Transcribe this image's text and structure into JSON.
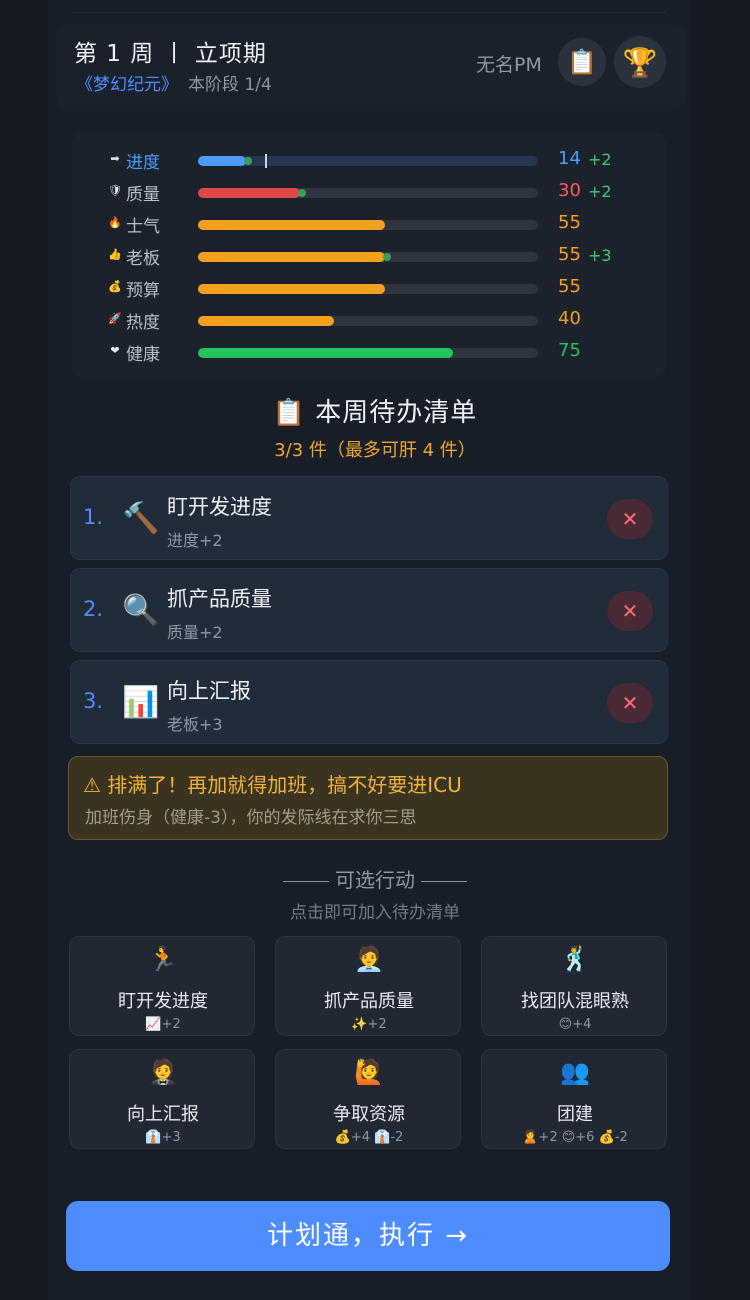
{
  "header": {
    "week_title": "第 1 周 丨 立项期",
    "project_name": "《梦幻纪元》",
    "stage": "本阶段 1/4",
    "pm_name": "无名PM",
    "clipboard_icon": "📋",
    "trophy_icon": "🏆"
  },
  "stats": [
    {
      "icon": "➡",
      "label": "进度",
      "value": "14",
      "delta": "+2",
      "fill": 0.14,
      "color": "#4d9bff",
      "value_color": "#4d9bff",
      "has_tick": true
    },
    {
      "icon": "🛡",
      "label": "质量",
      "value": "30",
      "delta": "+2",
      "fill": 0.3,
      "color": "#e04848",
      "value_color": "#ff5a5a"
    },
    {
      "icon": "🔥",
      "label": "士气",
      "value": "55",
      "delta": "",
      "fill": 0.55,
      "color": "#f5a01a",
      "value_color": "#f5a01a"
    },
    {
      "icon": "👍",
      "label": "老板",
      "value": "55",
      "delta": "+3",
      "fill": 0.55,
      "color": "#f5a01a",
      "value_color": "#f5a01a"
    },
    {
      "icon": "💰",
      "label": "预算",
      "value": "55",
      "delta": "",
      "fill": 0.55,
      "color": "#f5a01a",
      "value_color": "#f5a01a"
    },
    {
      "icon": "🚀",
      "label": "热度",
      "value": "40",
      "delta": "",
      "fill": 0.4,
      "color": "#f5a01a",
      "value_color": "#f5a01a"
    },
    {
      "icon": "❤",
      "label": "健康",
      "value": "75",
      "delta": "",
      "fill": 0.75,
      "color": "#22c55e",
      "value_color": "#22c55e"
    }
  ],
  "todo": {
    "title": "📋 本周待办清单",
    "subtitle": "3/3 件（最多可肝 4 件）",
    "remove_label": "✕",
    "items": [
      {
        "num": "1.",
        "emoji": "🔨",
        "name": "盯开发进度",
        "effect": "进度+2"
      },
      {
        "num": "2.",
        "emoji": "🔍",
        "name": "抓产品质量",
        "effect": "质量+2"
      },
      {
        "num": "3.",
        "emoji": "📊",
        "name": "向上汇报",
        "effect": "老板+3"
      }
    ]
  },
  "warning": {
    "title": "⚠ 排满了！再加就得加班，搞不好要进ICU",
    "subtitle": "加班伤身（健康-3），你的发际线在求你三思"
  },
  "actions": {
    "title": "可选行动",
    "subtitle": "点击即可加入待办清单",
    "items": [
      {
        "emoji": "🏃",
        "name": "盯开发进度",
        "effect": "📈+2"
      },
      {
        "emoji": "🧑‍💼",
        "name": "抓产品质量",
        "effect": "✨+2"
      },
      {
        "emoji": "🕺",
        "name": "找团队混眼熟",
        "effect": "😊+4"
      },
      {
        "emoji": "🤵",
        "name": "向上汇报",
        "effect": "👔+3"
      },
      {
        "emoji": "🙋",
        "name": "争取资源",
        "effect": "💰+4 👔-2"
      },
      {
        "emoji": "👥",
        "name": "团建",
        "effect": "🙎+2 😊+6 💰-2"
      }
    ]
  },
  "execute_label": "计划通，执行 →"
}
